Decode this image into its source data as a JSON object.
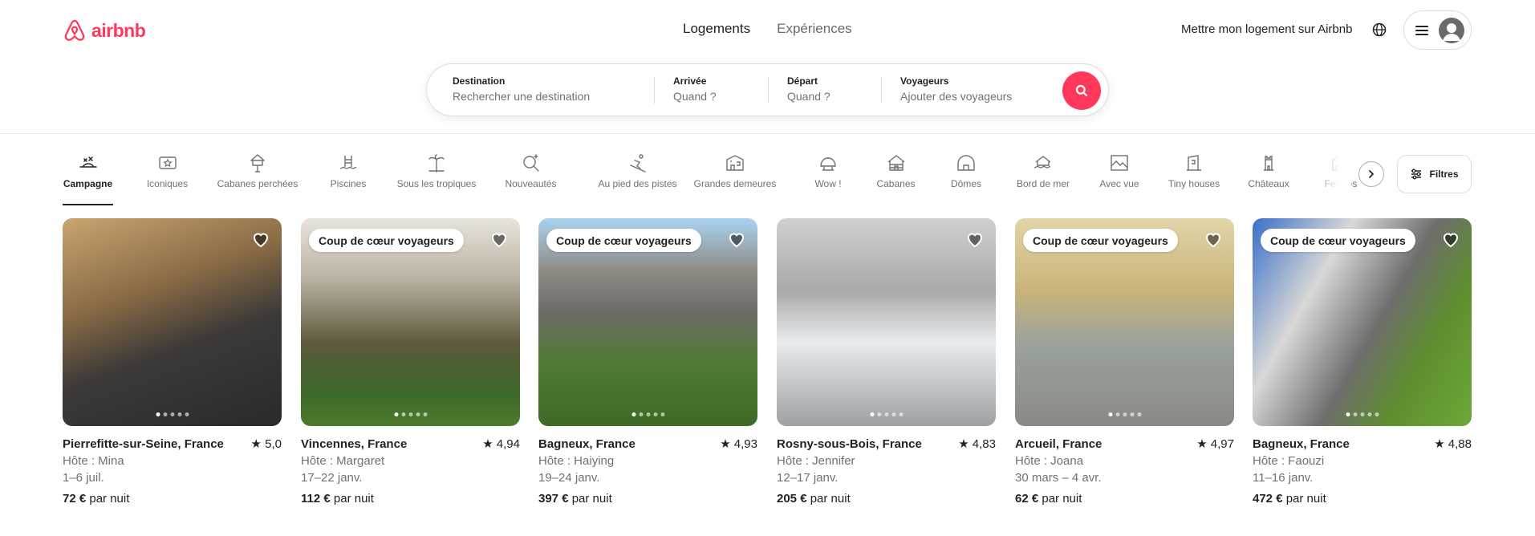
{
  "brand": {
    "logo_text": "airbnb",
    "color": "#ff385c"
  },
  "header": {
    "tabs": [
      {
        "label": "Logements",
        "active": true
      },
      {
        "label": "Expériences",
        "active": false
      }
    ],
    "host_link": "Mettre mon logement sur Airbnb"
  },
  "search": {
    "destination": {
      "label": "Destination",
      "placeholder": "Rechercher une destination"
    },
    "arrival": {
      "label": "Arrivée",
      "placeholder": "Quand ?"
    },
    "departure": {
      "label": "Départ",
      "placeholder": "Quand ?"
    },
    "travelers": {
      "label": "Voyageurs",
      "placeholder": "Ajouter des voyageurs"
    }
  },
  "categories": [
    {
      "label": "Campagne",
      "icon": "countryside-icon",
      "active": true
    },
    {
      "label": "Iconiques",
      "icon": "iconic-icon"
    },
    {
      "label": "Cabanes perchées",
      "icon": "treehouse-icon"
    },
    {
      "label": "Piscines",
      "icon": "pool-icon"
    },
    {
      "label": "Sous les tropiques",
      "icon": "tropical-icon"
    },
    {
      "label": "Nouveautés",
      "icon": "new-icon"
    },
    {
      "label": "Au pied des pistes",
      "icon": "ski-icon"
    },
    {
      "label": "Grandes demeures",
      "icon": "mansion-icon"
    },
    {
      "label": "Wow !",
      "icon": "omg-icon"
    },
    {
      "label": "Cabanes",
      "icon": "cabin-icon"
    },
    {
      "label": "Dômes",
      "icon": "dome-icon"
    },
    {
      "label": "Bord de mer",
      "icon": "beachfront-icon"
    },
    {
      "label": "Avec vue",
      "icon": "view-icon"
    },
    {
      "label": "Tiny houses",
      "icon": "tiny-house-icon"
    },
    {
      "label": "Châteaux",
      "icon": "castle-icon"
    },
    {
      "label": "Fermes",
      "icon": "farm-icon"
    }
  ],
  "filters_label": "Filtres",
  "badge_text": "Coup de cœur voyageurs",
  "listings": [
    {
      "title": "Pierrefitte-sur-Seine, France",
      "rating": "★ 5,0",
      "host": "Hôte : Mina",
      "dates": "1–6 juil.",
      "price": "72 €",
      "price_suffix": " par nuit",
      "badge": false
    },
    {
      "title": "Vincennes, France",
      "rating": "★ 4,94",
      "host": "Hôte : Margaret",
      "dates": "17–22 janv.",
      "price": "112 €",
      "price_suffix": " par nuit",
      "badge": true
    },
    {
      "title": "Bagneux, France",
      "rating": "★ 4,93",
      "host": "Hôte : Haiying",
      "dates": "19–24 janv.",
      "price": "397 €",
      "price_suffix": " par nuit",
      "badge": true
    },
    {
      "title": "Rosny-sous-Bois, France",
      "rating": "★ 4,83",
      "host": "Hôte : Jennifer",
      "dates": "12–17 janv.",
      "price": "205 €",
      "price_suffix": " par nuit",
      "badge": false
    },
    {
      "title": "Arcueil, France",
      "rating": "★ 4,97",
      "host": "Hôte : Joana",
      "dates": "30 mars – 4 avr.",
      "price": "62 €",
      "price_suffix": " par nuit",
      "badge": true
    },
    {
      "title": "Bagneux, France",
      "rating": "★ 4,88",
      "host": "Hôte : Faouzi",
      "dates": "11–16 janv.",
      "price": "472 €",
      "price_suffix": " par nuit",
      "badge": true
    }
  ]
}
